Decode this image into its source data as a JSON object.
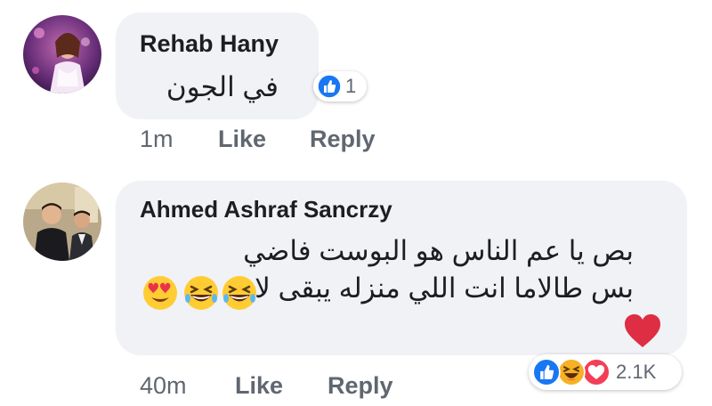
{
  "comments": [
    {
      "author": "Rehab Hany",
      "lines": [
        "في الجون"
      ],
      "time": "1m",
      "like_label": "Like",
      "reply_label": "Reply",
      "reactions": {
        "icons": [
          "like-icon"
        ],
        "count": "1"
      }
    },
    {
      "author": "Ahmed Ashraf Sancrzy",
      "lines": [
        "بص يا عم الناس هو البوست فاضي",
        "بس طالاما انت اللي منزله يبقى لاف"
      ],
      "emoji_line": [
        "heart-eyes-emoji",
        "grinning-squinting-emoji",
        "grinning-squinting-emoji"
      ],
      "trailing_emoji": "red-heart-emoji",
      "time": "40m",
      "like_label": "Like",
      "reply_label": "Reply",
      "reactions": {
        "icons": [
          "like-icon",
          "haha-icon",
          "love-icon"
        ],
        "count": "2.1K"
      }
    }
  ],
  "colors": {
    "bubble": "#f1f2f6",
    "like_blue": "#1877f2",
    "love_red": "#f33e58",
    "haha_yellow": "#f7b125",
    "meta_gray": "#606770"
  }
}
